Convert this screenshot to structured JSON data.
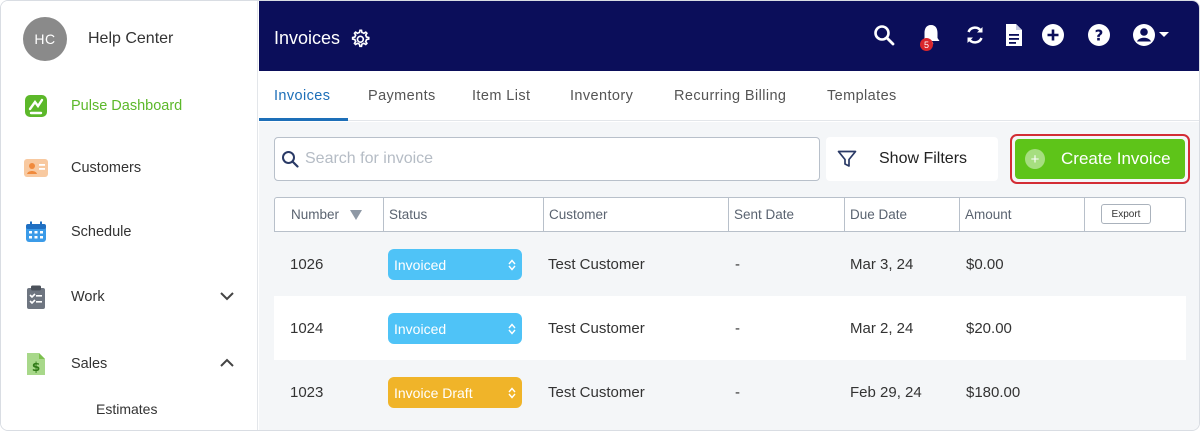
{
  "sidebar": {
    "avatar_initials": "HC",
    "title": "Help Center",
    "items": [
      {
        "label": "Pulse Dashboard",
        "icon": "pulse-icon",
        "active": true
      },
      {
        "label": "Customers",
        "icon": "customers-card-icon"
      },
      {
        "label": "Schedule",
        "icon": "calendar-icon"
      },
      {
        "label": "Work",
        "icon": "clipboard-icon",
        "expand": "chevron-down-icon"
      },
      {
        "label": "Sales",
        "icon": "dollar-document-icon",
        "expand": "chevron-up-icon"
      }
    ],
    "sub_items": [
      {
        "label": "Estimates"
      }
    ]
  },
  "topbar": {
    "title": "Invoices",
    "notification_count": "5",
    "icons": [
      "settings-gear-icon",
      "search-icon",
      "bell-icon",
      "sync-icon",
      "document-icon",
      "add-circle-icon",
      "help-icon",
      "account-icon"
    ]
  },
  "tabs": [
    {
      "label": "Invoices",
      "active": true
    },
    {
      "label": "Payments"
    },
    {
      "label": "Item List"
    },
    {
      "label": "Inventory"
    },
    {
      "label": "Recurring Billing"
    },
    {
      "label": "Templates"
    }
  ],
  "toolbar": {
    "search_placeholder": "Search for invoice",
    "filters_label": "Show Filters",
    "create_label": "Create Invoice"
  },
  "table": {
    "columns": [
      "Number",
      "Status",
      "Customer",
      "Sent Date",
      "Due Date",
      "Amount"
    ],
    "export_label": "Export",
    "rows": [
      {
        "number": "1026",
        "status": "Invoiced",
        "customer": "Test Customer",
        "sent": "-",
        "due": "Mar 3, 24",
        "amount": "$0.00"
      },
      {
        "number": "1024",
        "status": "Invoiced",
        "customer": "Test Customer",
        "sent": "-",
        "due": "Mar 2, 24",
        "amount": "$20.00"
      },
      {
        "number": "1023",
        "status": "Invoice Draft",
        "customer": "Test Customer",
        "sent": "-",
        "due": "Feb 29, 24",
        "amount": "$180.00"
      }
    ]
  },
  "colors": {
    "topbar": "#0b0e5a",
    "accent_blue": "#1d6fb8",
    "create_green": "#5ec419",
    "invoiced": "#4fc3f7",
    "draft": "#f0b429",
    "highlight_red": "#d32d35",
    "dashboard_green": "#5cb82a"
  }
}
